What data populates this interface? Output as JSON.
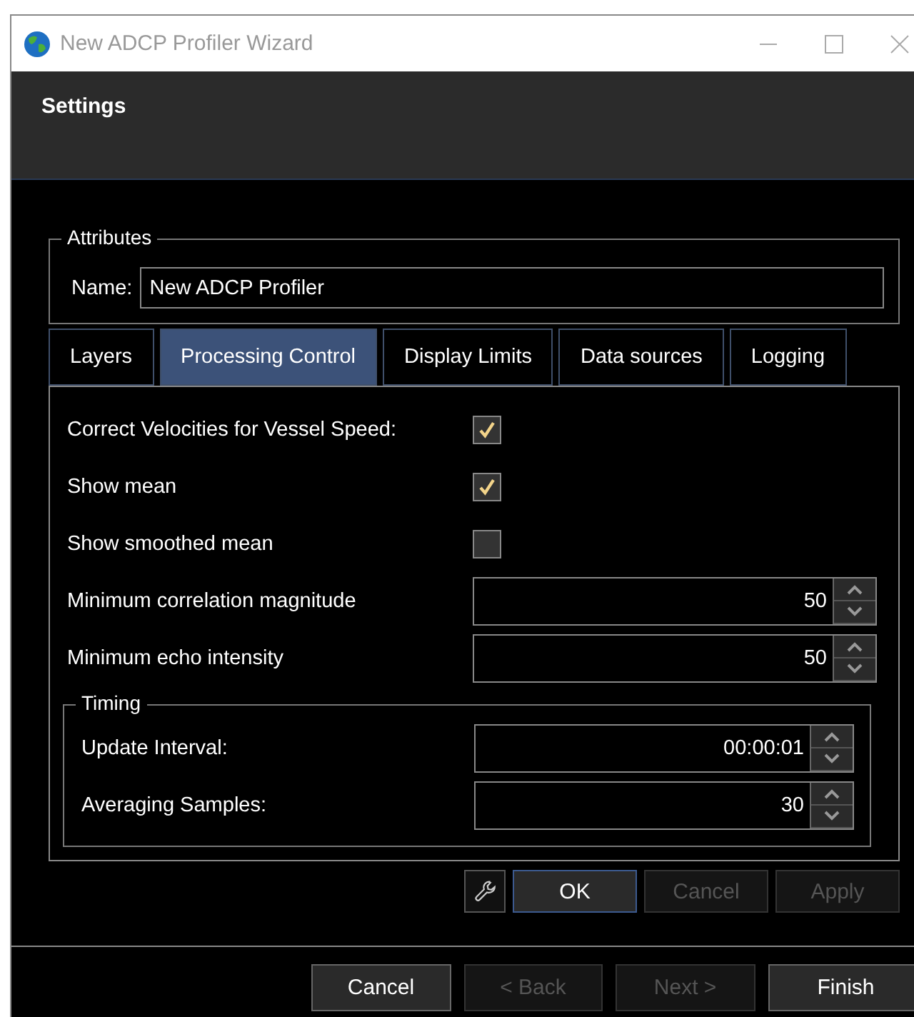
{
  "window": {
    "title": "New ADCP Profiler Wizard"
  },
  "header": {
    "title": "Settings"
  },
  "attributes": {
    "legend": "Attributes",
    "name_label": "Name:",
    "name_value": "New ADCP Profiler"
  },
  "tabs": [
    {
      "label": "Layers",
      "selected": false
    },
    {
      "label": "Processing Control",
      "selected": true
    },
    {
      "label": "Display Limits",
      "selected": false
    },
    {
      "label": "Data sources",
      "selected": false
    },
    {
      "label": "Logging",
      "selected": false
    }
  ],
  "settings": [
    {
      "kind": "checkbox",
      "label": "Correct Velocities for Vessel Speed:",
      "checked": true
    },
    {
      "kind": "checkbox",
      "label": "Show mean",
      "checked": true
    },
    {
      "kind": "checkbox",
      "label": "Show smoothed mean",
      "checked": false
    },
    {
      "kind": "spin",
      "label": "Minimum correlation magnitude",
      "value": "50"
    },
    {
      "kind": "spin",
      "label": "Minimum echo intensity",
      "value": "50"
    }
  ],
  "timing": {
    "legend": "Timing",
    "rows": [
      {
        "label": "Update Interval:",
        "value": "00:00:01"
      },
      {
        "label": "Averaging Samples:",
        "value": "30"
      }
    ]
  },
  "panel_buttons": [
    {
      "label": "OK",
      "disabled": false,
      "default": true
    },
    {
      "label": "Cancel",
      "disabled": true,
      "default": false
    },
    {
      "label": "Apply",
      "disabled": true,
      "default": false
    }
  ],
  "wizard_buttons": [
    {
      "label": "Cancel",
      "disabled": false
    },
    {
      "label": "< Back",
      "disabled": true
    },
    {
      "label": "Next >",
      "disabled": true
    },
    {
      "label": "Finish",
      "disabled": false
    }
  ]
}
